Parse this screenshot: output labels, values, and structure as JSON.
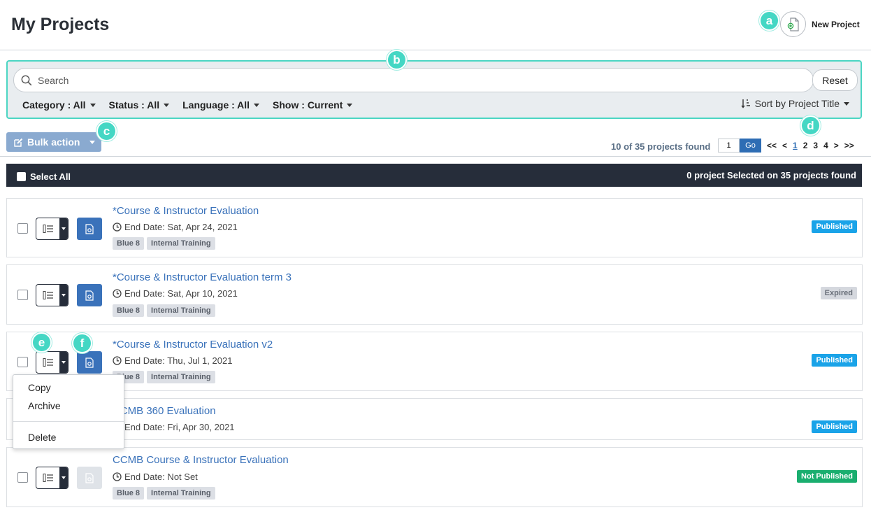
{
  "header": {
    "title": "My Projects",
    "new_project_label": "New Project"
  },
  "callouts": {
    "a": "a",
    "b": "b",
    "c": "c",
    "d": "d",
    "e": "e",
    "f": "f"
  },
  "filters": {
    "search_placeholder": "Search",
    "reset_label": "Reset",
    "category": "Category : All",
    "status": "Status : All",
    "language": "Language : All",
    "show": "Show : Current",
    "sort": "Sort by Project Title"
  },
  "toolbar": {
    "bulk_action_label": "Bulk action"
  },
  "pagination": {
    "found_text": "10 of 35 projects found",
    "page_value": "1",
    "go_label": "Go",
    "first": "<<",
    "prev": "<",
    "pages": [
      "1",
      "2",
      "3",
      "4"
    ],
    "next": ">",
    "last": ">>"
  },
  "select_bar": {
    "select_all_label": "Select All",
    "selected_text": "0 project Selected on 35 projects found"
  },
  "projects": [
    {
      "title": "*Course & Instructor Evaluation",
      "end_date": "End Date: Sat, Apr 24, 2021",
      "tags": [
        "Blue 8",
        "Internal Training"
      ],
      "status": "Published"
    },
    {
      "title": "*Course & Instructor Evaluation term 3",
      "end_date": "End Date: Sat, Apr 10, 2021",
      "tags": [
        "Blue 8",
        "Internal Training"
      ],
      "status": "Expired"
    },
    {
      "title": "*Course & Instructor Evaluation v2",
      "end_date": "End Date: Thu, Jul 1, 2021",
      "tags": [
        "Blue 8",
        "Internal Training"
      ],
      "status": "Published"
    },
    {
      "title": "CCMB 360 Evaluation",
      "end_date": "End Date: Fri, Apr 30, 2021",
      "tags": [],
      "status": "Published"
    },
    {
      "title": "CCMB Course & Instructor Evaluation",
      "end_date": "End Date: Not Set",
      "tags": [
        "Blue 8",
        "Internal Training"
      ],
      "status": "Not Published"
    }
  ],
  "context_menu": {
    "copy": "Copy",
    "archive": "Archive",
    "delete": "Delete"
  },
  "colors": {
    "accent": "#3a72ba",
    "callout": "#44d7c4",
    "published": "#1aa3e8",
    "expired": "#d5d8de",
    "not_published": "#1aae6f",
    "dark_bar": "#262d3a"
  }
}
